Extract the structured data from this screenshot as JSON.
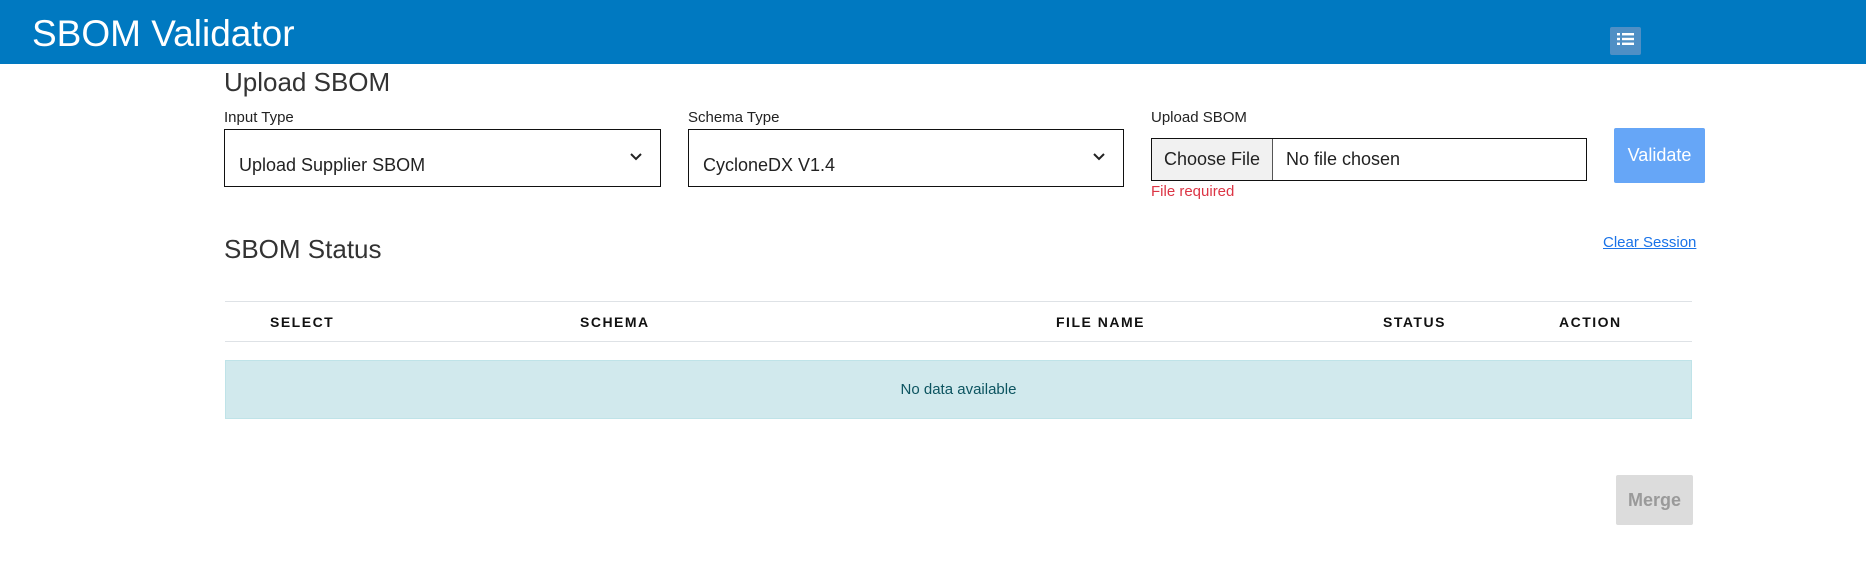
{
  "header": {
    "title": "SBOM Validator",
    "menu_icon": "list-icon"
  },
  "upload": {
    "title": "Upload SBOM",
    "input_type": {
      "label": "Input Type",
      "value": "Upload Supplier SBOM"
    },
    "schema_type": {
      "label": "Schema Type",
      "value": "CycloneDX V1.4"
    },
    "file": {
      "label": "Upload SBOM",
      "button_label": "Choose File",
      "value": "No file chosen",
      "error": "File required"
    },
    "validate_label": "Validate"
  },
  "status": {
    "title": "SBOM Status",
    "clear_label": "Clear Session",
    "columns": [
      "SELECT",
      "SCHEMA",
      "FILE NAME",
      "STATUS",
      "ACTION"
    ],
    "empty_message": "No data available",
    "merge_label": "Merge"
  },
  "colors": {
    "header_bg": "#0079c1",
    "validate_bg": "#66a6f7",
    "error": "#dc3545",
    "empty_bg": "#d1e9ed"
  }
}
